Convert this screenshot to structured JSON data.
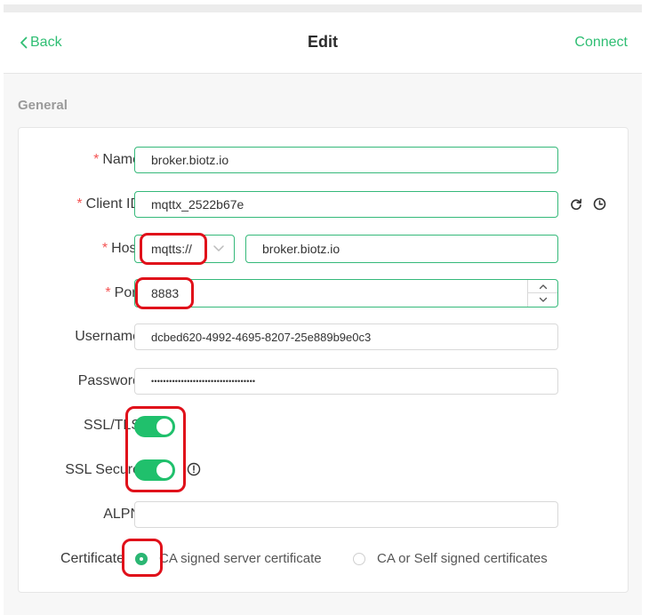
{
  "header": {
    "back_label": "Back",
    "title": "Edit",
    "connect_label": "Connect"
  },
  "section": {
    "general_title": "General"
  },
  "form": {
    "name": {
      "label": "Name",
      "value": "broker.biotz.io"
    },
    "client_id": {
      "label": "Client ID",
      "value": "mqttx_2522b67e"
    },
    "host": {
      "label": "Host",
      "protocol": "mqtts://",
      "value": "broker.biotz.io"
    },
    "port": {
      "label": "Port",
      "value": "8883"
    },
    "username": {
      "label": "Username",
      "value": "dcbed620-4992-4695-8207-25e889b9e0c3"
    },
    "password": {
      "label": "Password",
      "masked_value": "•••••••••••••••••••••••••••••••••••"
    },
    "ssl_tls": {
      "label": "SSL/TLS",
      "enabled": true
    },
    "ssl_secure": {
      "label": "SSL Secure",
      "enabled": true
    },
    "alpn": {
      "label": "ALPN",
      "value": ""
    },
    "certificate": {
      "label": "Certificate",
      "options": [
        "CA signed server certificate",
        "CA or Self signed certificates"
      ],
      "selected": "CA signed server certificate"
    }
  },
  "colors": {
    "accent": "#2fbe73",
    "required": "#f45454",
    "toggle_on": "#20c06c",
    "annotation": "#e0101a"
  },
  "icons": [
    "chevron-left-icon",
    "refresh-icon",
    "clock-icon",
    "chevron-down-icon",
    "chevron-up-icon",
    "info-icon"
  ]
}
